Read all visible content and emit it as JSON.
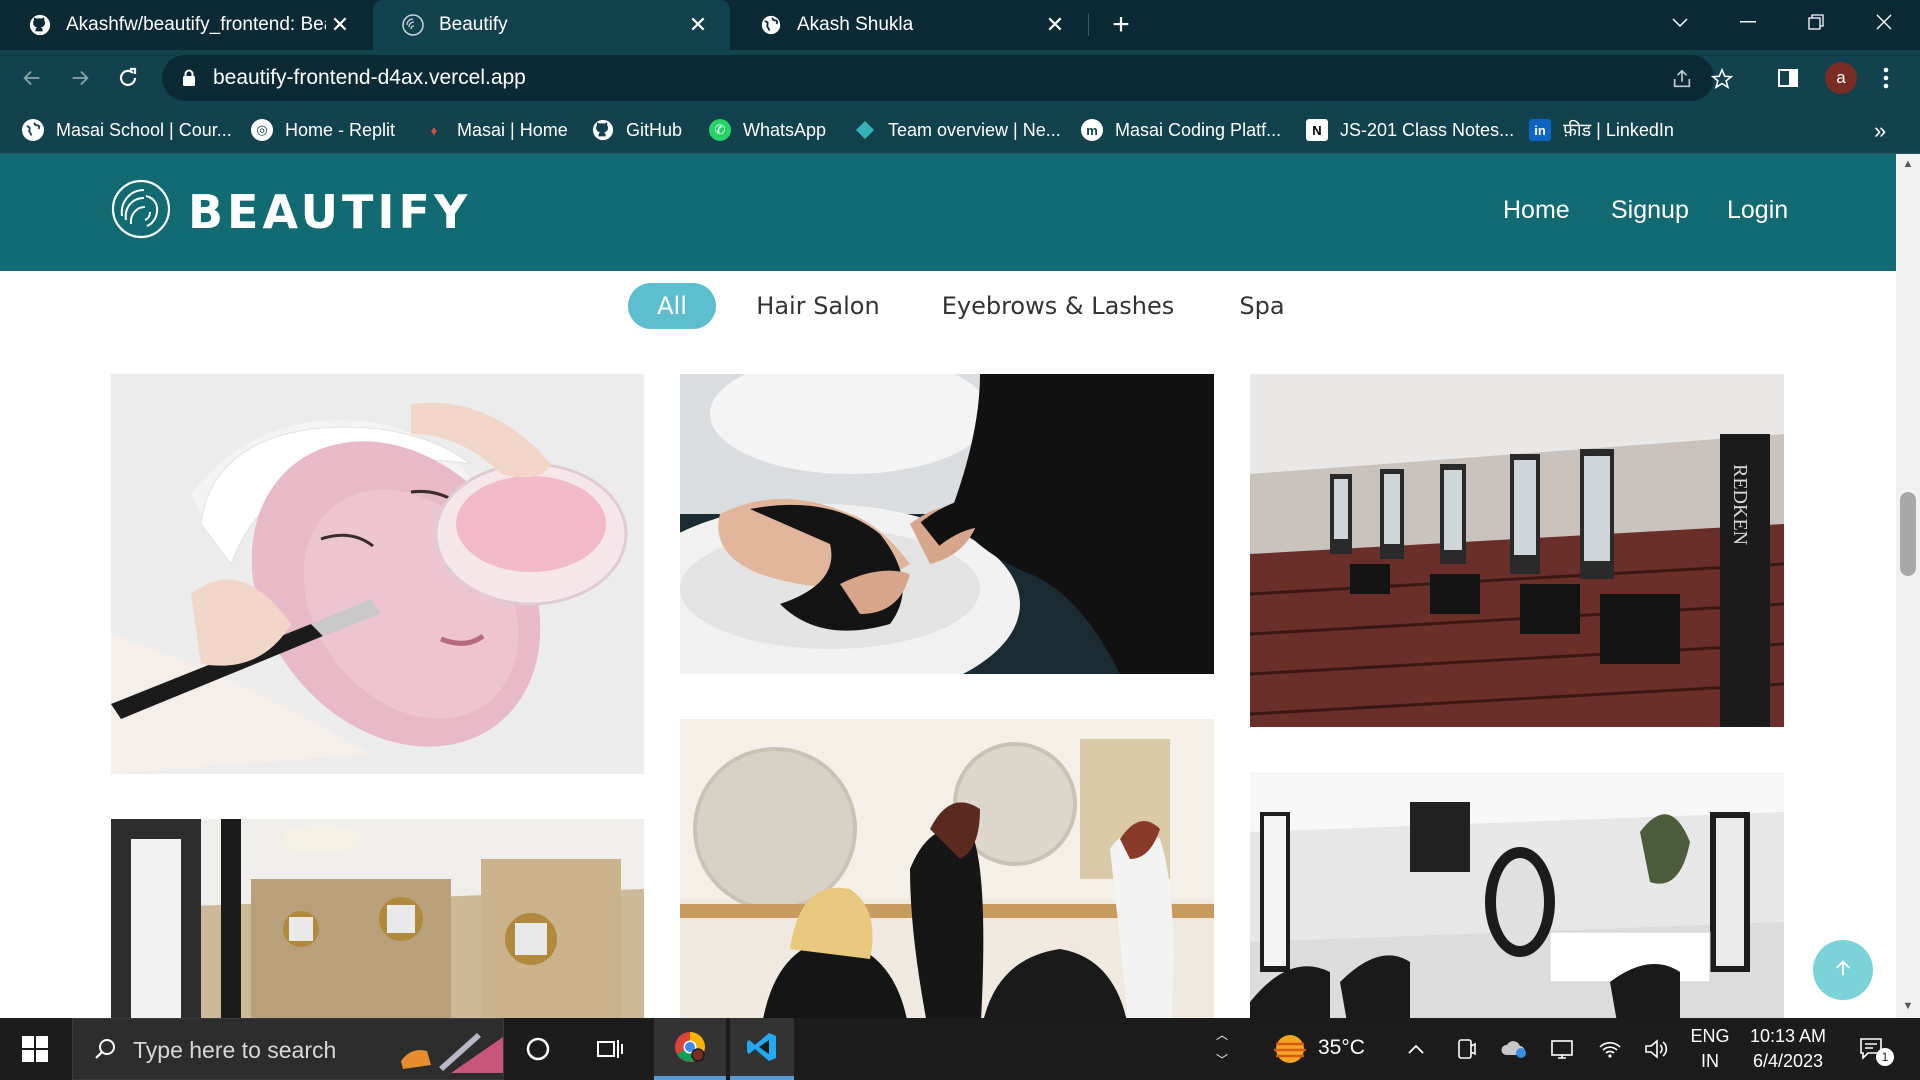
{
  "browser": {
    "tabs": [
      {
        "title": "Akashfw/beautify_frontend: Beau",
        "icon": "github-icon"
      },
      {
        "title": "Beautify",
        "icon": "beautify-logo-icon",
        "active": true
      },
      {
        "title": "Akash Shukla",
        "icon": "globe-icon"
      }
    ],
    "url": "beautify-frontend-d4ax.vercel.app",
    "profile_initial": "a",
    "bookmarks": [
      {
        "label": "Masai School | Cour...",
        "icon": "globe-icon"
      },
      {
        "label": "Home - Replit",
        "icon": "replit-icon"
      },
      {
        "label": "Masai | Home",
        "icon": "masai-icon"
      },
      {
        "label": "GitHub",
        "icon": "github-icon"
      },
      {
        "label": "WhatsApp",
        "icon": "whatsapp-icon"
      },
      {
        "label": "Team overview | Ne...",
        "icon": "netlify-icon"
      },
      {
        "label": "Masai Coding Platf...",
        "icon": "masai-m-icon"
      },
      {
        "label": "JS-201 Class Notes...",
        "icon": "notion-icon"
      },
      {
        "label": "फ़ीड | LinkedIn",
        "icon": "linkedin-icon"
      }
    ],
    "more_bookmarks": "»"
  },
  "site": {
    "brand": "BEAUTIFY",
    "nav": {
      "home": "Home",
      "signup": "Signup",
      "login": "Login"
    },
    "filters": [
      {
        "label": "All",
        "active": true
      },
      {
        "label": "Hair Salon",
        "active": false
      },
      {
        "label": "Eyebrows & Lashes",
        "active": false
      },
      {
        "label": "Spa",
        "active": false
      }
    ],
    "gallery": [
      {
        "name": "facial-mask-photo",
        "category": "Spa"
      },
      {
        "name": "hair-wash-photo",
        "category": "Hair Salon"
      },
      {
        "name": "salon-interior-redken-photo",
        "category": "Hair Salon"
      },
      {
        "name": "luxury-salon-interior-photo",
        "category": "Hair Salon"
      },
      {
        "name": "stylists-at-work-photo",
        "category": "Hair Salon"
      },
      {
        "name": "modern-salon-interior-photo",
        "category": "Hair Salon"
      }
    ],
    "colors": {
      "header": "#126b73",
      "accent": "#5dbfce",
      "scroll_button": "#7cd2d9"
    }
  },
  "taskbar": {
    "search_placeholder": "Type here to search",
    "weather": "35°C",
    "language_top": "ENG",
    "language_bottom": "IN",
    "time": "10:13 AM",
    "date": "6/4/2023",
    "notification_count": "1"
  }
}
